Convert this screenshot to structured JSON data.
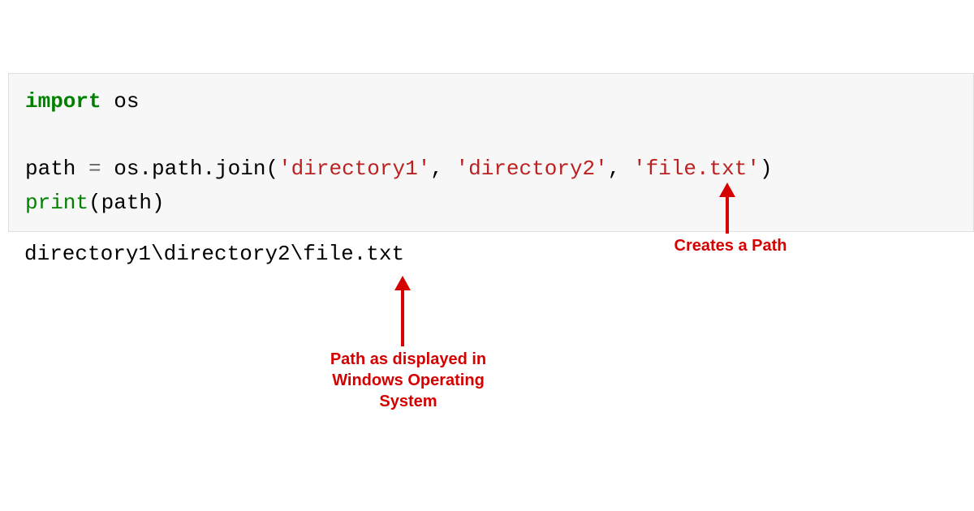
{
  "code": {
    "line1_keyword": "import",
    "line1_module": " os",
    "line2_var": "path ",
    "line2_equals": "=",
    "line2_expr_pre": " os.path.join(",
    "line2_str1": "'directory1'",
    "line2_comma1": ", ",
    "line2_str2": "'directory2'",
    "line2_comma2": ", ",
    "line2_str3": "'file.txt'",
    "line2_close": ")",
    "line3_print": "print",
    "line3_open": "(path)"
  },
  "output": "directory1\\directory2\\file.txt",
  "annotations": {
    "creates_path": "Creates a Path",
    "path_displayed": "Path as displayed in Windows Operating System"
  }
}
